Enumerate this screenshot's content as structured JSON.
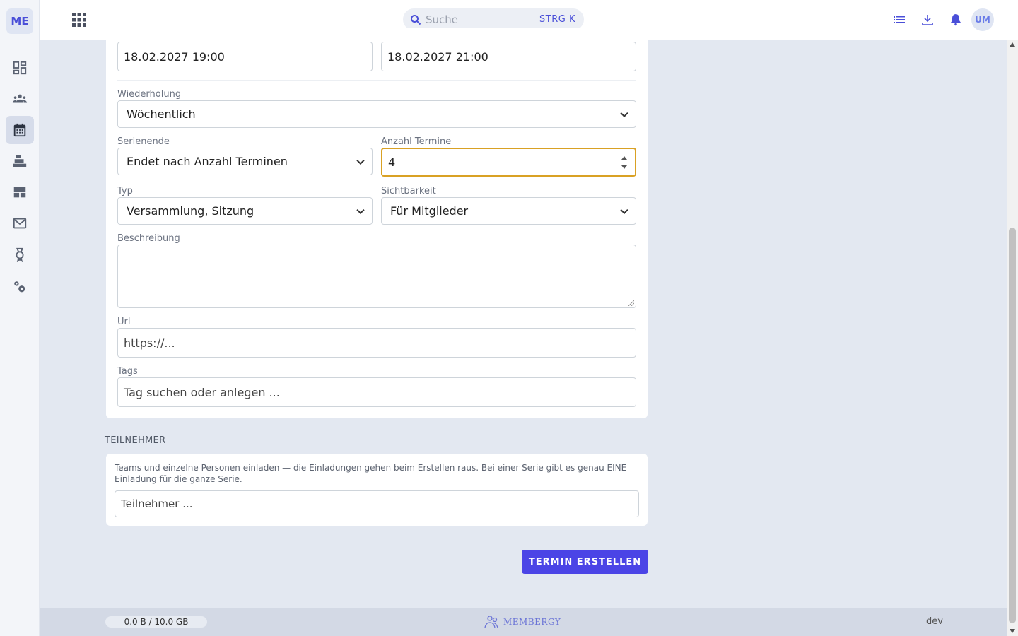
{
  "sidebar": {
    "logo": "ME",
    "items": [
      {
        "icon": "dashboard-icon"
      },
      {
        "icon": "members-icon"
      },
      {
        "icon": "calendar-icon",
        "active": true
      },
      {
        "icon": "cash-register-icon"
      },
      {
        "icon": "table-layout-icon"
      },
      {
        "icon": "mail-icon"
      },
      {
        "icon": "award-icon"
      },
      {
        "icon": "settings-icon"
      }
    ]
  },
  "topbar": {
    "search_placeholder": "Suche",
    "search_shortcut": "STRG K",
    "avatar_initials": "UM"
  },
  "form": {
    "start_value": "18.02.2027 19:00",
    "end_value": "18.02.2027 21:00",
    "recurrence_label": "Wiederholung",
    "recurrence_value": "Wöchentlich",
    "series_end_label": "Serienende",
    "series_end_value": "Endet nach Anzahl Terminen",
    "count_label": "Anzahl Termine",
    "count_value": "4",
    "type_label": "Typ",
    "type_value": "Versammlung, Sitzung",
    "visibility_label": "Sichtbarkeit",
    "visibility_value": "Für Mitglieder",
    "description_label": "Beschreibung",
    "description_value": "",
    "url_label": "Url",
    "url_placeholder": "https://...",
    "tags_label": "Tags",
    "tags_placeholder": "Tag suchen oder anlegen ..."
  },
  "participants": {
    "title": "TEILNEHMER",
    "hint": "Teams und einzelne Personen einladen — die Einladungen gehen beim Erstellen raus. Bei einer Serie gibt es genau EINE Einladung für die ganze Serie.",
    "input_placeholder": "Teilnehmer ..."
  },
  "submit_label": "TERMIN ERSTELLEN",
  "footer": {
    "storage": "0.0 B / 10.0 GB",
    "brand": "MEMBERGY",
    "env": "dev"
  },
  "colors": {
    "accent": "#4b44e6",
    "focus": "#d9a124",
    "background": "#e3e8f1"
  }
}
